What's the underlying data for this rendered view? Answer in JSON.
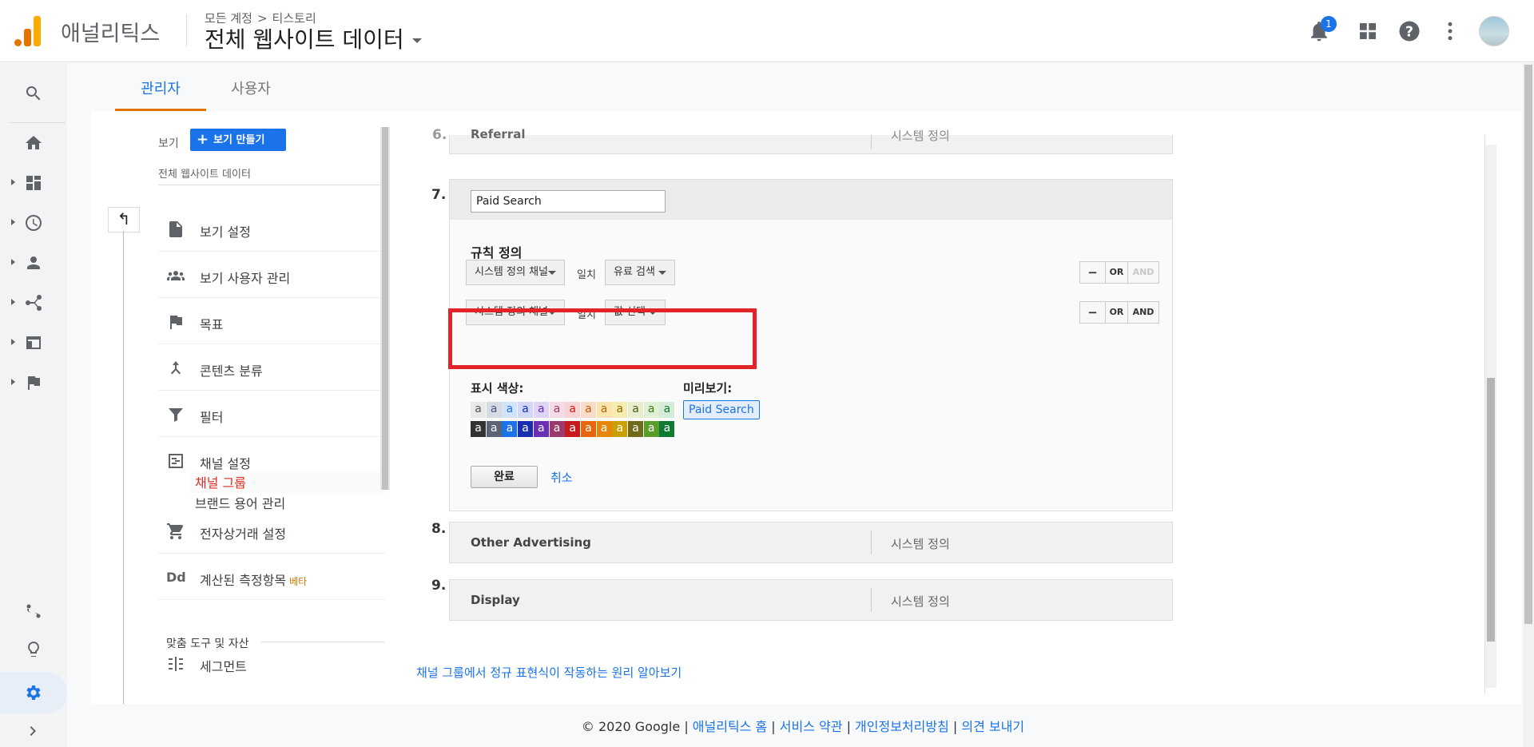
{
  "header": {
    "app_name": "애널리틱스",
    "breadcrumb_account": "모든 계정",
    "breadcrumb_sep": ">",
    "breadcrumb_property": "티스토리",
    "view_title": "전체 웹사이트 데이터",
    "notification_count": "1"
  },
  "tabs": {
    "admin": "관리자",
    "user": "사용자"
  },
  "view_column": {
    "label": "보기",
    "create_button": "보기 만들기",
    "view_name": "전체 웹사이트 데이터",
    "back_icon": "↰",
    "items": [
      {
        "label": "보기 설정"
      },
      {
        "label": "보기 사용자 관리"
      },
      {
        "label": "목표"
      },
      {
        "label": "콘텐츠 분류"
      },
      {
        "label": "필터"
      },
      {
        "label": "채널 설정"
      },
      {
        "label": "전자상거래 설정"
      },
      {
        "label": "계산된 측정항목",
        "badge": "베타"
      },
      {
        "label": "세그먼트"
      }
    ],
    "sub_items": {
      "channel_group": "채널 그룹",
      "brand_terms": "브랜드 용어 관리"
    },
    "section_label": "맞춤 도구 및 자산",
    "calc_icon_text": "Dd"
  },
  "editor": {
    "prev_group": {
      "number": "6.",
      "name": "Referral",
      "type": "시스템 정의"
    },
    "group7": {
      "number": "7.",
      "name_value": "Paid Search",
      "rule_title": "규칙 정의",
      "rules": [
        {
          "dimension": "시스템 정의 채널",
          "operator": "일치",
          "value": "유료 검색"
        },
        {
          "dimension": "시스템 정의 채널",
          "operator": "일치",
          "value": "값 선택"
        }
      ],
      "or_connector": "OR",
      "btn_minus": "−",
      "btn_or": "OR",
      "btn_and": "AND",
      "color_label": "표시 색상:",
      "preview_label": "미리보기:",
      "preview_text": "Paid Search",
      "swatch_letter": "a",
      "light_swatches": [
        "#e9e9e9",
        "#d7dbe3",
        "#d2e3fc",
        "#d2d7f7",
        "#e0d4f7",
        "#f4dce6",
        "#f9d4d4",
        "#fbdcc8",
        "#fbe3b0",
        "#f7ecb0",
        "#e9efcc",
        "#dff0d4",
        "#d4ecd8"
      ],
      "dark_swatches": [
        "#333333",
        "#5b6375",
        "#1a73e8",
        "#1a2fb0",
        "#6b2fb5",
        "#9b3a6e",
        "#c71a1a",
        "#e8650b",
        "#e8860b",
        "#c9a000",
        "#6f6b1a",
        "#5a9e2a",
        "#0f7a32"
      ],
      "done_button": "완료",
      "cancel_link": "취소"
    },
    "groups": [
      {
        "number": "8.",
        "name": "Other Advertising",
        "type": "시스템 정의"
      },
      {
        "number": "9.",
        "name": "Display",
        "type": "시스템 정의"
      }
    ],
    "learn_link": "채널 그룹에서 정규 표현식이 작동하는 원리 알아보기"
  },
  "footer": {
    "copyright": "© 2020 Google",
    "sep": "|",
    "link_home": "애널리틱스 홈",
    "link_terms": "서비스 약관",
    "link_privacy": "개인정보처리방침",
    "link_feedback": "의견 보내기"
  },
  "colors": {
    "accent": "#1a73e8",
    "brand_orange": "#e37400",
    "highlight_red": "#e2232a"
  }
}
